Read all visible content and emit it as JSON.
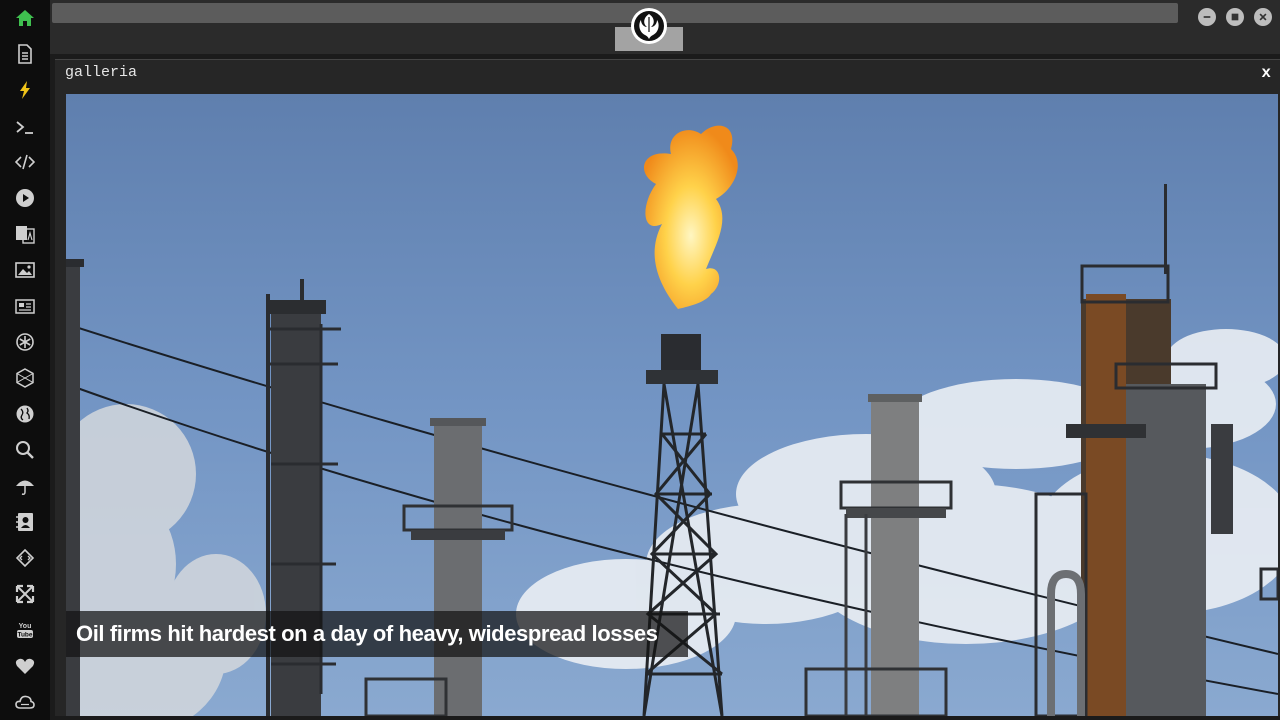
{
  "sidebar": {
    "items": [
      {
        "name": "home-icon",
        "color": "#3fbf4f"
      },
      {
        "name": "document-icon",
        "color": "#cfcfcf"
      },
      {
        "name": "bolt-icon",
        "color": "#f0c419"
      },
      {
        "name": "terminal-icon",
        "color": "#cfcfcf"
      },
      {
        "name": "code-icon",
        "color": "#cfcfcf"
      },
      {
        "name": "play-icon",
        "color": "#cfcfcf"
      },
      {
        "name": "translate-icon",
        "color": "#cfcfcf"
      },
      {
        "name": "image-icon",
        "color": "#cfcfcf"
      },
      {
        "name": "news-icon",
        "color": "#cfcfcf"
      },
      {
        "name": "settings-icon",
        "color": "#cfcfcf"
      },
      {
        "name": "hexagon-icon",
        "color": "#cfcfcf"
      },
      {
        "name": "globe-icon",
        "color": "#cfcfcf"
      },
      {
        "name": "search-icon",
        "color": "#cfcfcf"
      },
      {
        "name": "umbrella-icon",
        "color": "#cfcfcf"
      },
      {
        "name": "contacts-icon",
        "color": "#cfcfcf"
      },
      {
        "name": "diamond-code-icon",
        "color": "#cfcfcf"
      },
      {
        "name": "expand-icon",
        "color": "#cfcfcf"
      },
      {
        "name": "youtube-icon",
        "color": "#cfcfcf"
      },
      {
        "name": "heart-icon",
        "color": "#cfcfcf"
      },
      {
        "name": "cloud-icon",
        "color": "#cfcfcf"
      }
    ]
  },
  "topbar": {
    "emblem": "rebel-alliance-icon",
    "controls": [
      "minimize-icon",
      "maximize-icon",
      "close-icon"
    ]
  },
  "window": {
    "title": "galleria",
    "close_label": "x"
  },
  "gallery": {
    "caption": "Oil firms hit hardest on a day of heavy, widespread losses"
  },
  "colors": {
    "sidebar_bg": "#0d0d0d",
    "topbar_bg": "#2b2b2b",
    "window_bg": "#262626",
    "accent_home": "#3fbf4f",
    "accent_bolt": "#f0c419"
  }
}
